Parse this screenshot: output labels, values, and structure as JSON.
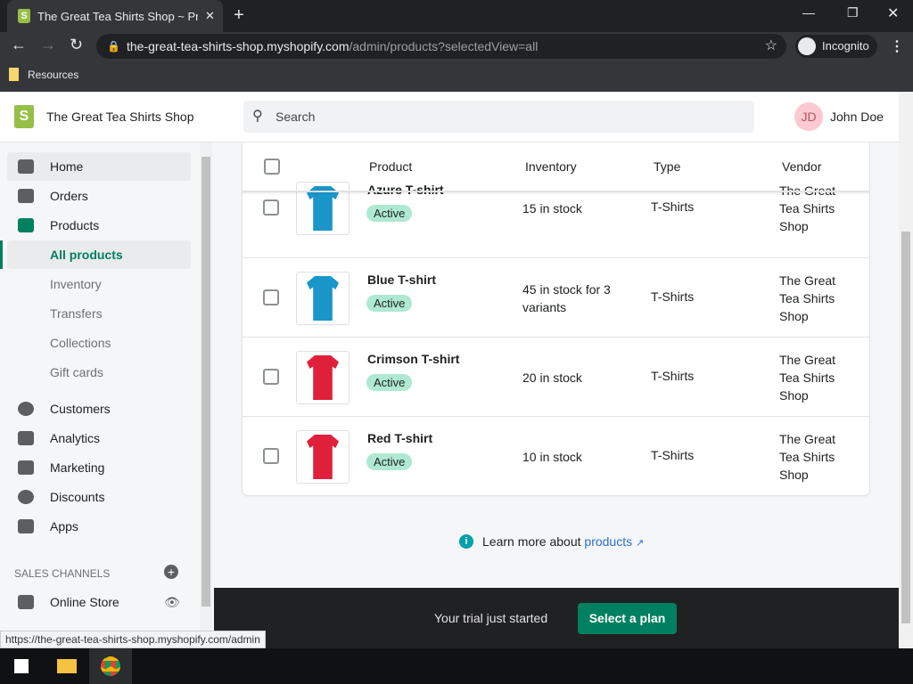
{
  "browser": {
    "tab_title": "The Great Tea Shirts Shop ~ Products",
    "url_host": "the-great-tea-shirts-shop.myshopify.com",
    "url_path": "/admin/products?selectedView=all",
    "incognito": "Incognito",
    "bookmark": "Resources",
    "status_url": "https://the-great-tea-shirts-shop.myshopify.com/admin"
  },
  "header": {
    "shop_name": "The Great Tea Shirts Shop",
    "search_placeholder": "Search",
    "avatar_initials": "JD",
    "user_name": "John Doe"
  },
  "sidebar": {
    "items": [
      {
        "label": "Home"
      },
      {
        "label": "Orders"
      },
      {
        "label": "Products"
      },
      {
        "label": "All products"
      },
      {
        "label": "Inventory"
      },
      {
        "label": "Transfers"
      },
      {
        "label": "Collections"
      },
      {
        "label": "Gift cards"
      },
      {
        "label": "Customers"
      },
      {
        "label": "Analytics"
      },
      {
        "label": "Marketing"
      },
      {
        "label": "Discounts"
      },
      {
        "label": "Apps"
      }
    ],
    "sales_channels": "SALES CHANNELS",
    "online_store": "Online Store"
  },
  "table": {
    "headers": {
      "product": "Product",
      "inventory": "Inventory",
      "type": "Type",
      "vendor": "Vendor"
    },
    "rows": [
      {
        "name": "Azure T-shirt",
        "status": "Active",
        "inventory": "15 in stock",
        "type": "T-Shirts",
        "vendor": "The Great Tea Shirts Shop",
        "color": "#1a96c8"
      },
      {
        "name": "Blue T-shirt",
        "status": "Active",
        "inventory": "45 in stock for 3 variants",
        "type": "T-Shirts",
        "vendor": "The Great Tea Shirts Shop",
        "color": "#1a96c8"
      },
      {
        "name": "Crimson T-shirt",
        "status": "Active",
        "inventory": "20 in stock",
        "type": "T-Shirts",
        "vendor": "The Great Tea Shirts Shop",
        "color": "#e0203a"
      },
      {
        "name": "Red T-shirt",
        "status": "Active",
        "inventory": "10 in stock",
        "type": "T-Shirts",
        "vendor": "The Great Tea Shirts Shop",
        "color": "#e0203a"
      }
    ]
  },
  "learn": {
    "text": "Learn more about ",
    "link": "products"
  },
  "footer": {
    "trial": "Your trial just started",
    "button": "Select a plan"
  }
}
